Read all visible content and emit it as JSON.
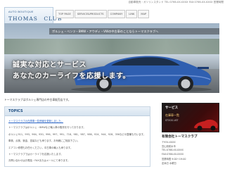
{
  "header": {
    "top_info": "自動車販売・ガソリンスタンド TEL:0766-XX-XXXX FAX:0766-XX-XXXX 営業時間",
    "logo_small": "AUTO BOUTIQUE",
    "logo_big": "THOMAS　CLUB"
  },
  "nav": [
    {
      "label": "TOP PAGE"
    },
    {
      "label": "SERVICE&PRODUCTS"
    },
    {
      "label": "COMPANY"
    },
    {
      "label": "LINK"
    },
    {
      "label": "MAP"
    }
  ],
  "hero": {
    "marquee": "ポルシェ・ベンツ・BMW・アウディ・VWの中古車のことならトーマスクラブへ",
    "tagline1": "誠実な対応とサービス",
    "tagline2": "あなたのカーライフを応援します。"
  },
  "intro_text": "トーマスクラブはポルシェ専門店の中古車販売店です。",
  "topics": {
    "title": "TOPICS",
    "lines": [
      {
        "text": "トーマスクラブの在庫車一覧情報を更新しました。",
        "link": true
      },
      {
        "text": "トーマスクラブはポルシェ・BMWなど輸入車の販売を行っております。",
        "link": false
      },
      {
        "text": "ポルシェ911、993、964、930、996、997、991、718、981、987、986、924、944、928、356などの整備も行います。",
        "link": false
      },
      {
        "text": "車検、点検、鈑金、塗装なども承ります。お気軽にご相談下さい。",
        "link": false
      },
      {
        "text": "エアコン修理もお任せください。中古車の輸入も承ります。",
        "link": false
      },
      {
        "text": "トーマスクラブではカーライフを応援いたします。",
        "link": false
      },
      {
        "text": "お問い合わせはお電話・FAXまたはメールにて承ります。",
        "link": false
      }
    ]
  },
  "side": {
    "banner_title": "サービス",
    "banner_text": "在庫車一覧",
    "banner_sub": "STOCK LIST",
    "company_title": "有限会社トーマスクラブ",
    "lines": [
      "〒934-XXXX",
      "富山県射水市",
      "TEL:0766-XX-XXXX",
      "FAX:0766-XX-XXXX",
      "営業時間 9:00～19:00",
      "定休日 水曜日"
    ]
  }
}
